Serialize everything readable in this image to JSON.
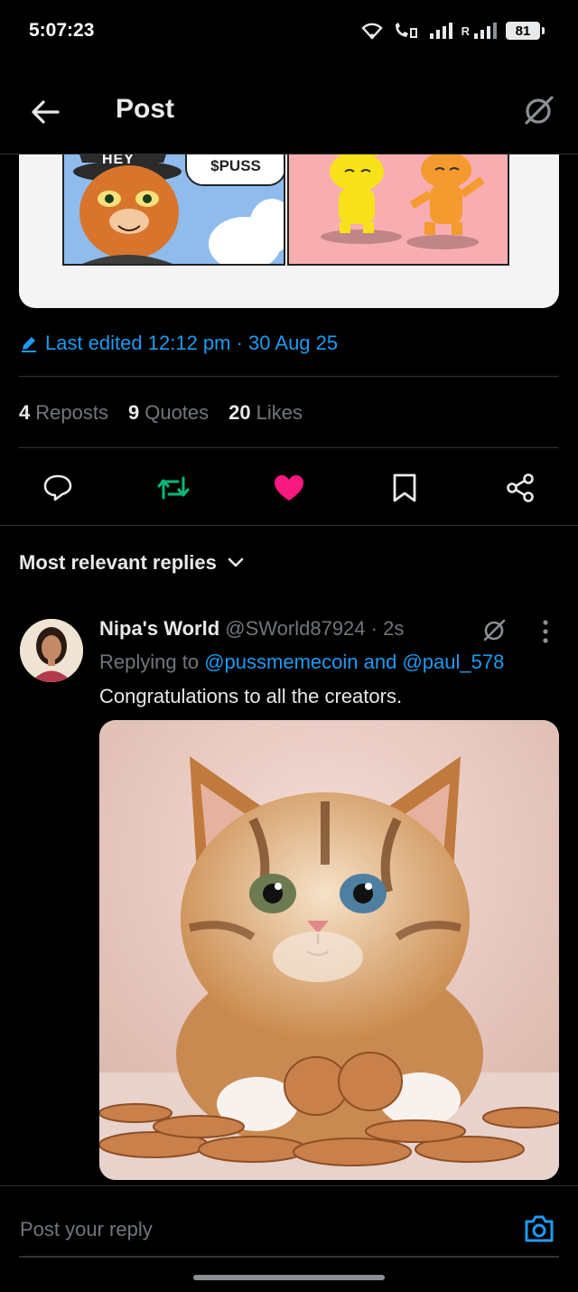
{
  "status_bar": {
    "time": "5:07:23",
    "network_label": "R",
    "battery": "81"
  },
  "header": {
    "title": "Post",
    "back_icon": "arrow-left-icon",
    "grok_icon": "grok-icon"
  },
  "media": {
    "bubble_text": "$PUSS",
    "partial_text": "HEY"
  },
  "post_meta": {
    "edited_text": "Last edited 12:12 pm · 30 Aug 25"
  },
  "stats": [
    {
      "count": "4",
      "label": "Reposts"
    },
    {
      "count": "9",
      "label": "Quotes"
    },
    {
      "count": "20",
      "label": "Likes"
    }
  ],
  "actions": {
    "reply_icon": "comment-icon",
    "repost_icon": "repost-icon",
    "like_icon": "heart-icon",
    "bookmark_icon": "bookmark-icon",
    "share_icon": "share-icon",
    "repost_color": "#00ba7c",
    "like_color": "#f91880"
  },
  "replies": {
    "sort_label": "Most relevant replies",
    "items": [
      {
        "name": "Nipa's World",
        "handle": "@SWorld87924",
        "time": "2s",
        "replying_prefix": "Replying to",
        "replying_user1": "@pussmemecoin",
        "replying_and": "and",
        "replying_user2": "@paul_578",
        "text": "Congratulations to all the creators."
      }
    ]
  },
  "composer": {
    "placeholder": "Post your reply"
  },
  "colors": {
    "accent": "#1d9bf0",
    "background": "#000000",
    "muted": "#71767b",
    "divider": "#2f3336"
  }
}
